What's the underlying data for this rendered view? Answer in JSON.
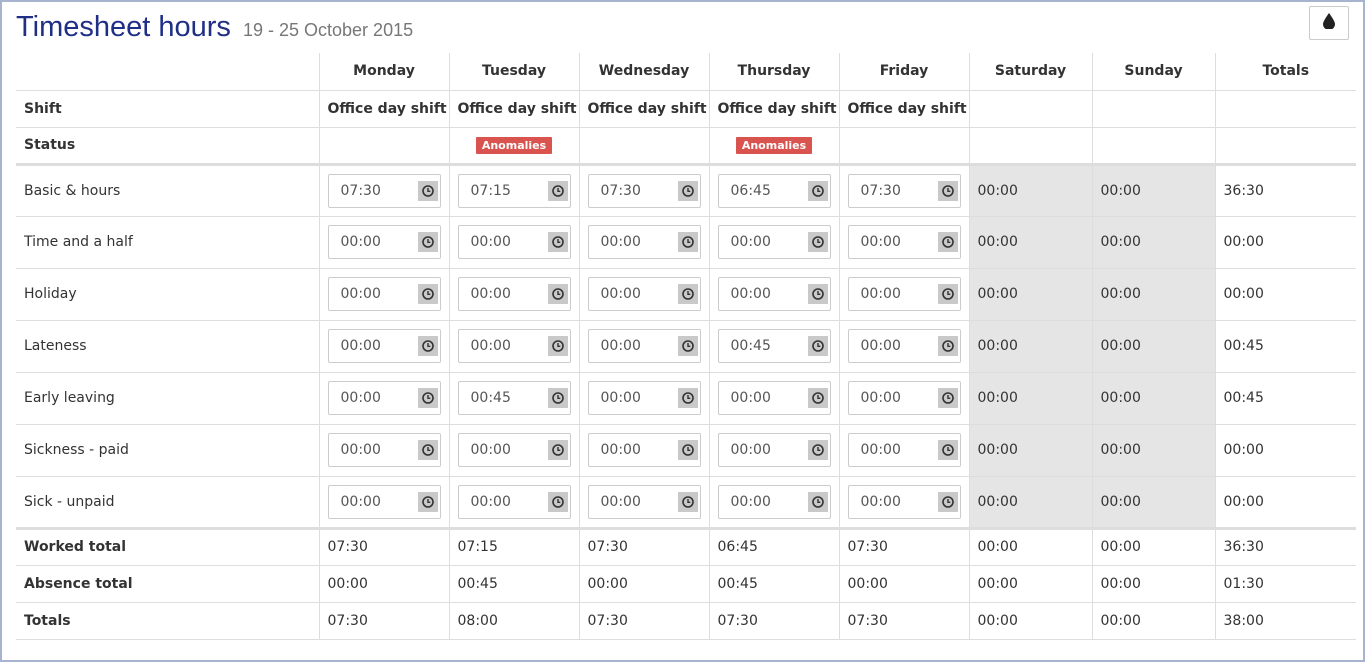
{
  "header": {
    "title": "Timesheet hours",
    "date_range": "19 - 25 October 2015"
  },
  "days": [
    "Monday",
    "Tuesday",
    "Wednesday",
    "Thursday",
    "Friday",
    "Saturday",
    "Sunday"
  ],
  "totals_label": "Totals",
  "shift": {
    "label": "Shift",
    "values": [
      "Office day shift",
      "Office day shift",
      "Office day shift",
      "Office day shift",
      "Office day shift",
      "",
      ""
    ]
  },
  "status": {
    "label": "Status",
    "values": [
      "",
      "Anomalies",
      "",
      "Anomalies",
      "",
      "",
      ""
    ]
  },
  "rows": [
    {
      "label": "Basic & hours",
      "values": [
        "07:30",
        "07:15",
        "07:30",
        "06:45",
        "07:30",
        "00:00",
        "00:00"
      ],
      "total": "36:30"
    },
    {
      "label": "Time and a half",
      "values": [
        "00:00",
        "00:00",
        "00:00",
        "00:00",
        "00:00",
        "00:00",
        "00:00"
      ],
      "total": "00:00"
    },
    {
      "label": "Holiday",
      "values": [
        "00:00",
        "00:00",
        "00:00",
        "00:00",
        "00:00",
        "00:00",
        "00:00"
      ],
      "total": "00:00"
    },
    {
      "label": "Lateness",
      "values": [
        "00:00",
        "00:00",
        "00:00",
        "00:45",
        "00:00",
        "00:00",
        "00:00"
      ],
      "total": "00:45"
    },
    {
      "label": "Early leaving",
      "values": [
        "00:00",
        "00:45",
        "00:00",
        "00:00",
        "00:00",
        "00:00",
        "00:00"
      ],
      "total": "00:45"
    },
    {
      "label": "Sickness - paid",
      "values": [
        "00:00",
        "00:00",
        "00:00",
        "00:00",
        "00:00",
        "00:00",
        "00:00"
      ],
      "total": "00:00"
    },
    {
      "label": "Sick - unpaid",
      "values": [
        "00:00",
        "00:00",
        "00:00",
        "00:00",
        "00:00",
        "00:00",
        "00:00"
      ],
      "total": "00:00"
    }
  ],
  "footer": [
    {
      "label": "Worked total",
      "values": [
        "07:30",
        "07:15",
        "07:30",
        "06:45",
        "07:30",
        "00:00",
        "00:00"
      ],
      "total": "36:30"
    },
    {
      "label": "Absence total",
      "values": [
        "00:00",
        "00:45",
        "00:00",
        "00:45",
        "00:00",
        "00:00",
        "00:00"
      ],
      "total": "01:30"
    },
    {
      "label": "Totals",
      "values": [
        "07:30",
        "08:00",
        "07:30",
        "07:30",
        "07:30",
        "00:00",
        "00:00"
      ],
      "total": "38:00"
    }
  ],
  "icons": {
    "clock": "clock-icon",
    "theme": "water-drop-icon"
  },
  "colors": {
    "title": "#1f2f86",
    "badge": "#d9534f",
    "weekend_bg": "#e5e5e5"
  }
}
